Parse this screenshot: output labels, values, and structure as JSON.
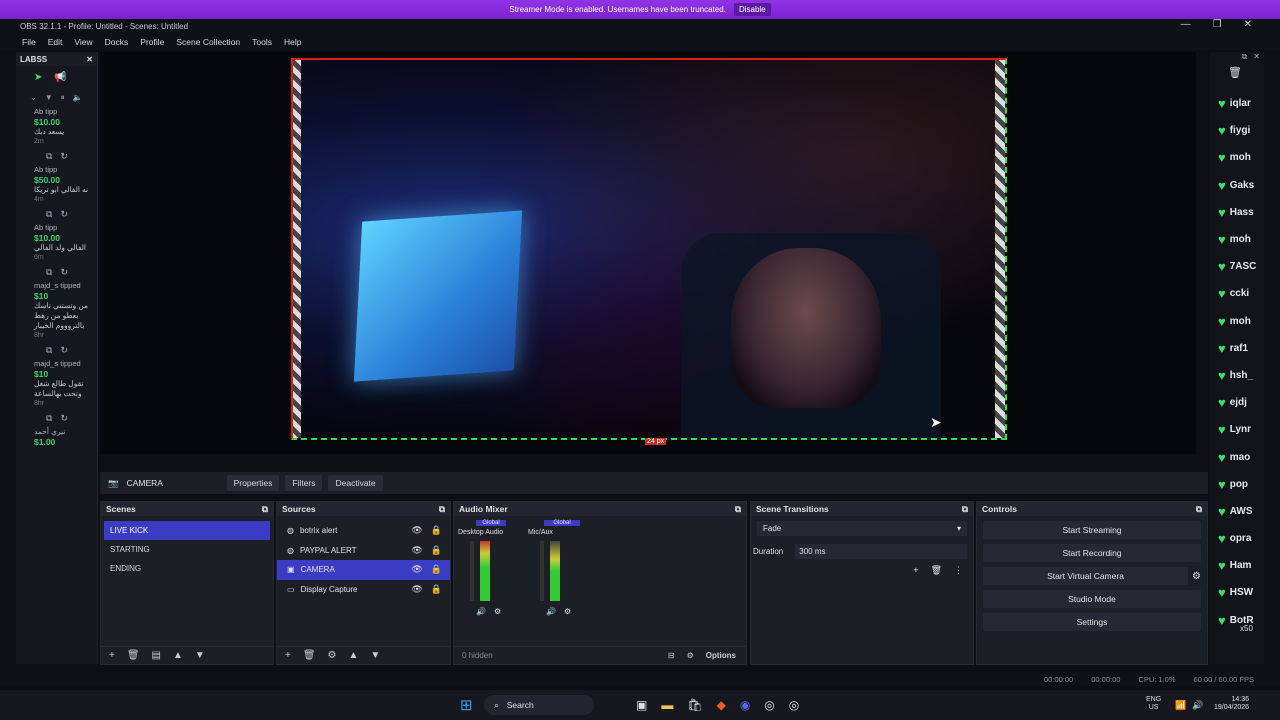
{
  "banner": {
    "text": "Streamer Mode is enabled. Usernames have been truncated.",
    "button": "Disable"
  },
  "window": {
    "title": "OBS 32.1.1 - Profile: Untitled - Scenes: Untitled",
    "controls": [
      "—",
      "❐",
      "✕"
    ]
  },
  "menu": [
    "File",
    "Edit",
    "View",
    "Docks",
    "Profile",
    "Scene Collection",
    "Tools",
    "Help"
  ],
  "labss": {
    "title": "LABSS",
    "tips": [
      {
        "name": "Ab tipp",
        "amount": "$10.00",
        "message": "يسعد ديك",
        "ago": "2m"
      },
      {
        "name": "Ab tipp",
        "amount": "$50.00",
        "message": "نه الفالي ابو تريكا",
        "ago": "4m"
      },
      {
        "name": "Ab tipp",
        "amount": "$10.00",
        "message": "الفالي ولد الفالي",
        "ago": "6m"
      },
      {
        "name": "majd_s tipped",
        "amount": "$10",
        "message": "من وتستني ناسك بعطو من رهط بالتروووم الخيبار",
        "ago": "8hr"
      },
      {
        "name": "majd_s tipped",
        "amount": "$10",
        "message": "تقول طالع شغل وتحت بهالساعة",
        "ago": "8hr"
      },
      {
        "name": "تيري أحمد",
        "amount": "$1.00",
        "message": "",
        "ago": ""
      }
    ]
  },
  "source_bar": {
    "selected": "CAMERA",
    "properties": "Properties",
    "filters": "Filters",
    "deactivate": "Deactivate"
  },
  "preview": {
    "label": "24 px"
  },
  "scenes": {
    "title": "Scenes",
    "items": [
      "LIVE KICK",
      "STARTING",
      "ENDING"
    ],
    "selected": 0
  },
  "sources": {
    "title": "Sources",
    "items": [
      "botrix alert",
      "PAYPAL ALERT",
      "CAMERA",
      "Display Capture"
    ],
    "selected": 2
  },
  "audio": {
    "title": "Audio Mixer",
    "channels": [
      {
        "name": "Desktop Audio",
        "tag": "Global"
      },
      {
        "name": "Mic/Aux",
        "tag": "Global"
      }
    ],
    "hidden": "0 hidden",
    "options": "Options"
  },
  "transitions": {
    "title": "Scene Transitions",
    "type": "Fade",
    "duration_label": "Duration",
    "duration": "300 ms"
  },
  "controls": {
    "title": "Controls",
    "buttons": [
      "Start Streaming",
      "Start Recording",
      "Start Virtual Camera",
      "Studio Mode",
      "Settings"
    ]
  },
  "status": {
    "time1": "00:00:00",
    "time2": "00:00:00",
    "cpu": "CPU: 1.0%",
    "fps": "60.00 / 60.00 FPS"
  },
  "taskbar": {
    "search": "Search",
    "lang": "ENG",
    "region": "US",
    "time": "14:36",
    "date": "19/04/2026"
  },
  "chat": {
    "users": [
      "iqlar",
      "fiygi",
      "moh",
      "Gaks",
      "Hass",
      "moh",
      "7ASC",
      "ccki",
      "moh",
      "raf1",
      "hsh_",
      "ejdj",
      "Lynr",
      "mao",
      "pop",
      "AWS",
      "opra",
      "Ham",
      "HSW",
      "BotR"
    ],
    "last": "x50"
  },
  "colors": {
    "accent": "#3a3dc4",
    "banner": "#8a2be2",
    "green": "#3ee06a",
    "selection_red": "#e01b1b"
  }
}
